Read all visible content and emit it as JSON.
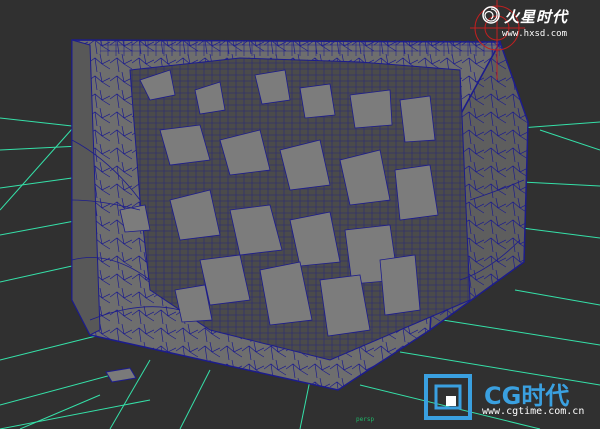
{
  "viewport": {
    "status_text": "persp"
  },
  "watermark_top": {
    "title": "火星时代",
    "url": "www.hxsd.com",
    "icon": "spiral-logo-icon"
  },
  "watermark_bottom": {
    "title": "CG时代",
    "url": "www.cgtime.com.cn",
    "icon": "cg-logo-icon"
  },
  "colors": {
    "background": "#303030",
    "grid": "#35e0a8",
    "wireframe": "#1c1c8c",
    "mesh_fill": "#6e6e6e",
    "origin_marker": "#c02020"
  }
}
